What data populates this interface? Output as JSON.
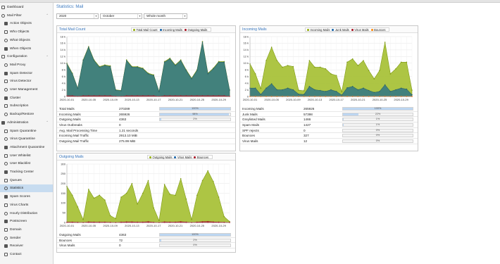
{
  "sidebar": {
    "items": [
      {
        "label": "Dashboard",
        "icon": "dashboard-icon"
      },
      {
        "label": "Mail Filter",
        "icon": "filter-icon",
        "expandable": true
      },
      {
        "label": "Action Objects",
        "icon": "action-icon"
      },
      {
        "label": "Who Objects",
        "icon": "user-icon"
      },
      {
        "label": "What Objects",
        "icon": "envelope-icon"
      },
      {
        "label": "When Objects",
        "icon": "clock-icon"
      },
      {
        "label": "Configuration",
        "icon": "gear-icon",
        "expandable": true
      },
      {
        "label": "Mail Proxy",
        "icon": "envelope-icon"
      },
      {
        "label": "Spam Detector",
        "icon": "bug-icon"
      },
      {
        "label": "Virus Detector",
        "icon": "virus-icon"
      },
      {
        "label": "User Management",
        "icon": "users-icon"
      },
      {
        "label": "Cluster",
        "icon": "server-icon"
      },
      {
        "label": "Subscription",
        "icon": "support-icon"
      },
      {
        "label": "Backup/Restore",
        "icon": "floppy-icon"
      },
      {
        "label": "Administration",
        "icon": "wrench-icon",
        "expandable": true
      },
      {
        "label": "Spam Quarantine",
        "icon": "envelope-icon"
      },
      {
        "label": "Virus Quarantine",
        "icon": "bug-icon"
      },
      {
        "label": "Attachment Quarantine",
        "icon": "paperclip-icon"
      },
      {
        "label": "User Whitelist",
        "icon": "file-icon"
      },
      {
        "label": "User Blacklist",
        "icon": "file-dark-icon"
      },
      {
        "label": "Tracking Center",
        "icon": "list-icon"
      },
      {
        "label": "Queues",
        "icon": "bars-icon"
      },
      {
        "label": "Statistics",
        "icon": "chart-icon",
        "active": true
      },
      {
        "label": "Spam Scores",
        "icon": "table-icon"
      },
      {
        "label": "Virus Charts",
        "icon": "bug-icon"
      },
      {
        "label": "Hourly Distribution",
        "icon": "pie-icon"
      },
      {
        "label": "Postscreen",
        "icon": "line-chart-icon"
      },
      {
        "label": "Domain",
        "icon": "table-icon"
      },
      {
        "label": "Sender",
        "icon": "table-icon"
      },
      {
        "label": "Receiver",
        "icon": "table-icon"
      },
      {
        "label": "Contact",
        "icon": "table-icon"
      }
    ]
  },
  "page": {
    "title": "Statistics: Mail"
  },
  "filters": {
    "year": "2020",
    "month": "October",
    "range": "Whole month"
  },
  "colors": {
    "total": "#94ae0a",
    "incoming": "#115fa6",
    "outgoing": "#a61120",
    "virus": "#a61120",
    "junk": "#115fa6",
    "bounces": "#ff8809",
    "area_green": "#a9c23a",
    "area_teal": "#3c7d80",
    "accent": "#3a78bf"
  },
  "panels": {
    "total": {
      "title": "Total Mail Count",
      "legend": [
        "Total Mail Count",
        "Incoming Mails",
        "Outgoing Mails"
      ],
      "table": [
        {
          "label": "Total Mails",
          "value": "270289",
          "bar": 1.0,
          "pct": "100%"
        },
        {
          "label": "Incoming Mails",
          "value": "265926",
          "bar": 0.98,
          "pct": "98%"
        },
        {
          "label": "Outgoing Mails",
          "value": "4363",
          "bar": 0.02,
          "pct": "2%"
        },
        {
          "label": "Virus Outbreaks",
          "value": "0"
        },
        {
          "label": "Avg. Mail Processing Time",
          "value": "1.21 seconds"
        },
        {
          "label": "Incoming Mail Traffic",
          "value": "2913.10 MiB"
        },
        {
          "label": "Outgoing Mail Traffic",
          "value": "275.99 MiB"
        }
      ]
    },
    "incoming": {
      "title": "Incoming Mails",
      "legend": [
        "Incoming Mails",
        "Junk Mails",
        "Virus Mails",
        "Bounces"
      ],
      "table": [
        {
          "label": "Incoming Mails",
          "value": "265926",
          "bar": 1.0,
          "pct": "100%"
        },
        {
          "label": "Junk Mails",
          "value": "57398",
          "bar": 0.22,
          "pct": "22%"
        },
        {
          "label": "Greylisted Mails",
          "value": "1466",
          "bar": 0.01,
          "pct": "1%"
        },
        {
          "label": "Spam Mails",
          "value": "1427",
          "bar": 0.01,
          "pct": "1%"
        },
        {
          "label": "SPF rejects",
          "value": "0",
          "bar": 0,
          "pct": "0%"
        },
        {
          "label": "Bounces",
          "value": "327",
          "bar": 0,
          "pct": "0%"
        },
        {
          "label": "Virus Mails",
          "value": "12",
          "bar": 0,
          "pct": "0%"
        }
      ]
    },
    "outgoing": {
      "title": "Outgoing Mails",
      "legend": [
        "Outgoing Mails",
        "Virus Mails",
        "Bounces"
      ],
      "table": [
        {
          "label": "Outgoing Mails",
          "value": "4363",
          "bar": 1.0,
          "pct": "100%"
        },
        {
          "label": "Bounces",
          "value": "72",
          "bar": 0.02,
          "pct": "2%"
        },
        {
          "label": "Virus Mails",
          "value": "0",
          "bar": 0,
          "pct": "0%"
        }
      ]
    }
  },
  "chart_data": [
    {
      "type": "area",
      "chart": "total",
      "ylim": [
        0,
        18000
      ],
      "yticks": [
        "0",
        "2 k",
        "4 k",
        "6 k",
        "8 k",
        "10 k",
        "12 k",
        "14 k",
        "16 k",
        "18 k"
      ],
      "xticks": [
        "2020-10-01",
        "2020-10-05",
        "2020-10-09",
        "2020-10-13",
        "2020-10-17",
        "2020-10-21",
        "2020-10-25",
        "2020-10-29"
      ],
      "x": [
        "2020-10-01",
        "2020-10-02",
        "2020-10-03",
        "2020-10-04",
        "2020-10-05",
        "2020-10-06",
        "2020-10-07",
        "2020-10-08",
        "2020-10-09",
        "2020-10-10",
        "2020-10-11",
        "2020-10-12",
        "2020-10-13",
        "2020-10-14",
        "2020-10-15",
        "2020-10-16",
        "2020-10-17",
        "2020-10-18",
        "2020-10-19",
        "2020-10-20",
        "2020-10-21",
        "2020-10-22",
        "2020-10-23",
        "2020-10-24",
        "2020-10-25",
        "2020-10-26",
        "2020-10-27",
        "2020-10-28",
        "2020-10-29",
        "2020-10-30",
        "2020-10-31"
      ],
      "series": [
        {
          "name": "Total Mail Count",
          "values": [
            10000,
            7000,
            2500,
            11000,
            15000,
            11000,
            9000,
            9500,
            9200,
            2000,
            1800,
            11000,
            9000,
            9000,
            8500,
            7000,
            6500,
            1500,
            10500,
            11500,
            9500,
            11000,
            8000,
            5500,
            8000,
            16500,
            7000,
            8500,
            10500,
            10500,
            2000
          ]
        },
        {
          "name": "Incoming Mails",
          "values": [
            9800,
            6800,
            2400,
            10800,
            14800,
            10800,
            8800,
            9300,
            9000,
            1900,
            1700,
            10800,
            8800,
            8800,
            8300,
            6800,
            6300,
            1400,
            10300,
            11300,
            9300,
            10800,
            7800,
            5300,
            7800,
            16300,
            6800,
            8300,
            10300,
            10300,
            1900
          ]
        },
        {
          "name": "Outgoing Mails",
          "values": [
            200,
            200,
            50,
            200,
            200,
            200,
            200,
            200,
            200,
            40,
            40,
            200,
            200,
            200,
            200,
            200,
            200,
            40,
            200,
            200,
            200,
            200,
            200,
            200,
            200,
            200,
            200,
            200,
            200,
            200,
            40
          ]
        }
      ]
    },
    {
      "type": "area",
      "chart": "incoming",
      "ylim": [
        0,
        18000
      ],
      "yticks": [
        "0",
        "2 k",
        "4 k",
        "6 k",
        "8 k",
        "10 k",
        "12 k",
        "14 k",
        "16 k",
        "18 k"
      ],
      "xticks": [
        "2020-10-01",
        "2020-10-05",
        "2020-10-09",
        "2020-10-13",
        "2020-10-17",
        "2020-10-21",
        "2020-10-25",
        "2020-10-29"
      ],
      "x": [
        "2020-10-01",
        "2020-10-02",
        "2020-10-03",
        "2020-10-04",
        "2020-10-05",
        "2020-10-06",
        "2020-10-07",
        "2020-10-08",
        "2020-10-09",
        "2020-10-10",
        "2020-10-11",
        "2020-10-12",
        "2020-10-13",
        "2020-10-14",
        "2020-10-15",
        "2020-10-16",
        "2020-10-17",
        "2020-10-18",
        "2020-10-19",
        "2020-10-20",
        "2020-10-21",
        "2020-10-22",
        "2020-10-23",
        "2020-10-24",
        "2020-10-25",
        "2020-10-26",
        "2020-10-27",
        "2020-10-28",
        "2020-10-29",
        "2020-10-30",
        "2020-10-31"
      ],
      "series": [
        {
          "name": "Incoming Mails",
          "values": [
            9800,
            6800,
            2400,
            10800,
            14800,
            10800,
            8800,
            9300,
            9000,
            1900,
            1700,
            10800,
            8800,
            8800,
            8300,
            6800,
            6300,
            1400,
            10300,
            11300,
            9300,
            10800,
            7800,
            5300,
            7800,
            16300,
            6800,
            8300,
            10300,
            10300,
            1900
          ]
        },
        {
          "name": "Junk Mails",
          "values": [
            2500,
            2500,
            600,
            2500,
            3800,
            2000,
            2000,
            2500,
            2000,
            700,
            600,
            3000,
            2000,
            1800,
            1500,
            2000,
            1500,
            400,
            2600,
            3000,
            2000,
            2500,
            1800,
            1200,
            1500,
            3500,
            1500,
            2000,
            2500,
            2200,
            500
          ]
        },
        {
          "name": "Virus Mails",
          "values": [
            0,
            0,
            0,
            0,
            0,
            0,
            0,
            0,
            0,
            0,
            0,
            0,
            0,
            0,
            0,
            0,
            0,
            0,
            0,
            0,
            0,
            0,
            0,
            0,
            0,
            0,
            0,
            0,
            0,
            0,
            0
          ]
        },
        {
          "name": "Bounces",
          "values": [
            10,
            10,
            5,
            10,
            20,
            10,
            10,
            10,
            10,
            5,
            5,
            10,
            10,
            10,
            10,
            10,
            10,
            5,
            10,
            10,
            10,
            10,
            10,
            10,
            10,
            20,
            10,
            10,
            10,
            10,
            5
          ]
        }
      ]
    },
    {
      "type": "area",
      "chart": "outgoing",
      "ylim": [
        0,
        300
      ],
      "yticks": [
        "0",
        "50",
        "100",
        "150",
        "200",
        "250",
        "300"
      ],
      "xticks": [
        "2020-10-01",
        "2020-10-05",
        "2020-10-09",
        "2020-10-13",
        "2020-10-17",
        "2020-10-21",
        "2020-10-25",
        "2020-10-29"
      ],
      "x": [
        "2020-10-01",
        "2020-10-02",
        "2020-10-03",
        "2020-10-04",
        "2020-10-05",
        "2020-10-06",
        "2020-10-07",
        "2020-10-08",
        "2020-10-09",
        "2020-10-10",
        "2020-10-11",
        "2020-10-12",
        "2020-10-13",
        "2020-10-14",
        "2020-10-15",
        "2020-10-16",
        "2020-10-17",
        "2020-10-18",
        "2020-10-19",
        "2020-10-20",
        "2020-10-21",
        "2020-10-22",
        "2020-10-23",
        "2020-10-24",
        "2020-10-25",
        "2020-10-26",
        "2020-10-27",
        "2020-10-28",
        "2020-10-29",
        "2020-10-30",
        "2020-10-31"
      ],
      "series": [
        {
          "name": "Outgoing Mails",
          "values": [
            185,
            140,
            80,
            15,
            170,
            125,
            140,
            115,
            35,
            20,
            130,
            150,
            200,
            95,
            150,
            215,
            75,
            10,
            195,
            145,
            140,
            225,
            120,
            15,
            140,
            215,
            265,
            210,
            130,
            30,
            5
          ]
        },
        {
          "name": "Virus Mails",
          "values": [
            0,
            0,
            0,
            0,
            0,
            0,
            0,
            0,
            0,
            0,
            0,
            0,
            0,
            0,
            0,
            0,
            0,
            0,
            0,
            0,
            0,
            0,
            0,
            0,
            0,
            0,
            0,
            0,
            0,
            0,
            0
          ]
        },
        {
          "name": "Bounces",
          "values": [
            2,
            2,
            1,
            0,
            3,
            2,
            2,
            2,
            1,
            0,
            2,
            3,
            3,
            2,
            2,
            4,
            1,
            0,
            3,
            2,
            2,
            4,
            2,
            0,
            2,
            4,
            5,
            3,
            2,
            1,
            0
          ]
        }
      ]
    }
  ]
}
